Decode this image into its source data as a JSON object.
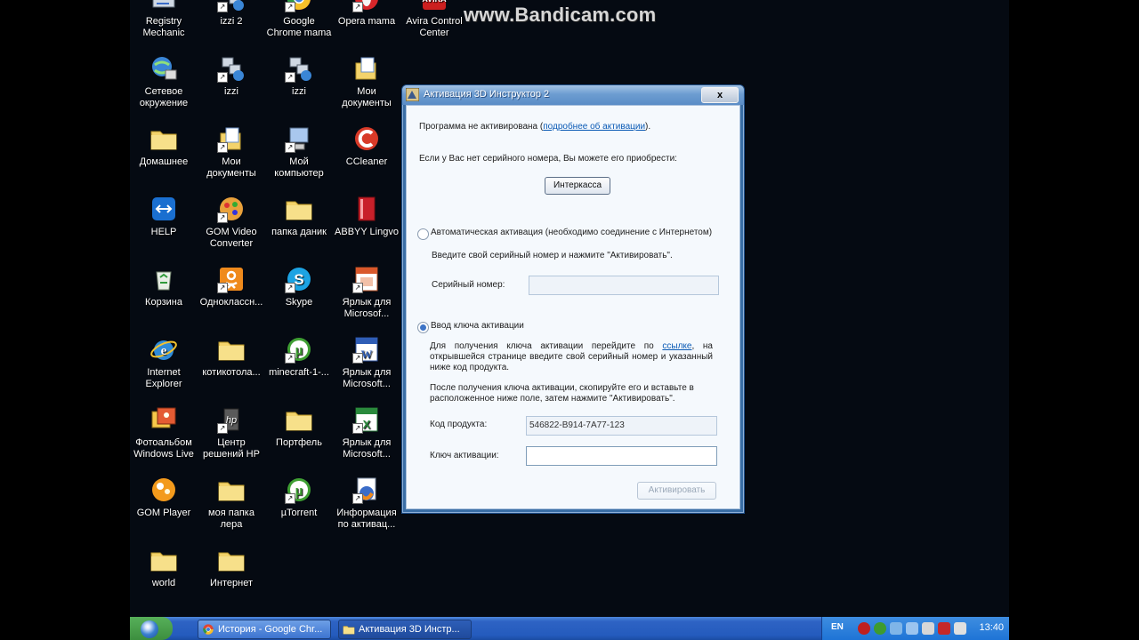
{
  "watermark": "www.Bandicam.com",
  "desktop_icons": [
    {
      "label": "Registry Mechanic",
      "icon": "registry-mechanic-icon"
    },
    {
      "label": "izzi 2",
      "icon": "network-shortcut-icon"
    },
    {
      "label": "Google Chrome mama",
      "icon": "chrome-icon"
    },
    {
      "label": "Opera mama",
      "icon": "opera-icon"
    },
    {
      "label": "Avira Control Center",
      "icon": "avira-icon"
    },
    {
      "label": "Сетевое окружение",
      "icon": "network-globe-icon"
    },
    {
      "label": "izzi",
      "icon": "network-shortcut-icon"
    },
    {
      "label": "izzi",
      "icon": "network-shortcut-icon"
    },
    {
      "label": "Мои документы",
      "icon": "my-documents-icon"
    },
    {
      "label": "Домашнее",
      "icon": "folder-icon"
    },
    {
      "label": "Мои документы",
      "icon": "my-documents-icon"
    },
    {
      "label": "Мой компьютер",
      "icon": "my-computer-icon"
    },
    {
      "label": "CCleaner",
      "icon": "ccleaner-icon"
    },
    {
      "label": "HELP",
      "icon": "teamviewer-icon"
    },
    {
      "label": "GOM Video Converter",
      "icon": "gom-converter-icon"
    },
    {
      "label": "папка даник",
      "icon": "folder-icon"
    },
    {
      "label": "ABBYY Lingvo",
      "icon": "lingvo-icon"
    },
    {
      "label": "Корзина",
      "icon": "recycle-bin-icon"
    },
    {
      "label": "Одноклассн...",
      "icon": "odnoklassniki-icon"
    },
    {
      "label": "Skype",
      "icon": "skype-icon"
    },
    {
      "label": "Ярлык для Microsof...",
      "icon": "powerpoint-icon"
    },
    {
      "label": "Internet Explorer",
      "icon": "internet-explorer-icon"
    },
    {
      "label": "котикотола...",
      "icon": "folder-icon"
    },
    {
      "label": "minecraft-1-...",
      "icon": "utorrent-icon"
    },
    {
      "label": "Ярлык для Microsoft...",
      "icon": "word-icon"
    },
    {
      "label": "Фотоальбом Windows Live",
      "icon": "photo-gallery-icon"
    },
    {
      "label": "Центр решений HP",
      "icon": "hp-icon"
    },
    {
      "label": "Портфель",
      "icon": "folder-icon"
    },
    {
      "label": "Ярлык для Microsoft...",
      "icon": "excel-icon"
    },
    {
      "label": "GOM Player",
      "icon": "gom-player-icon"
    },
    {
      "label": "моя папка лера",
      "icon": "folder-icon"
    },
    {
      "label": "µTorrent",
      "icon": "utorrent-icon"
    },
    {
      "label": "Информация по активац...",
      "icon": "firefox-icon"
    },
    {
      "label": "world",
      "icon": "folder-icon"
    },
    {
      "label": "Интернет",
      "icon": "folder-icon"
    }
  ],
  "dialog": {
    "title": "Активация 3D Инструктор 2",
    "close_label": "x",
    "status_prefix": "Программа не активирована (",
    "status_link": "подробнее об активации",
    "status_suffix": ").",
    "buy_text": "Если у Вас нет серийного номера, Вы можете его приобрести:",
    "buy_button": "Интеркасса",
    "auto_radio_label": "Автоматическая активация (необходимо соединение с Интернетом)",
    "auto_hint": "Введите свой серийный номер и нажмите \"Активировать\".",
    "serial_label": "Серийный номер:",
    "serial_value": "",
    "key_radio_label": "Ввод ключа активации",
    "key_text_1_prefix": "Для получения ключа активации перейдите по ",
    "key_text_1_link": "ссылке",
    "key_text_1_suffix": ", на открывшейся странице введите свой серийный номер и указанный ниже код продукта.",
    "key_text_2": "После получения ключа активации, скопируйте его и вставьте в расположенное ниже поле, затем нажмите \"Активировать\".",
    "product_code_label": "Код продукта:",
    "product_code_value": "546822-B914-7A77-123",
    "activation_key_label": "Ключ активации:",
    "activation_key_value": "",
    "activate_button": "Активировать",
    "selected_option": "key"
  },
  "taskbar": {
    "tasks": [
      {
        "label": "История - Google Chr...",
        "icon": "chrome-icon",
        "active": false
      },
      {
        "label": "Активация 3D Инстр...",
        "icon": "app-3d-icon",
        "active": true
      }
    ],
    "language": "EN",
    "clock": "13:40"
  }
}
